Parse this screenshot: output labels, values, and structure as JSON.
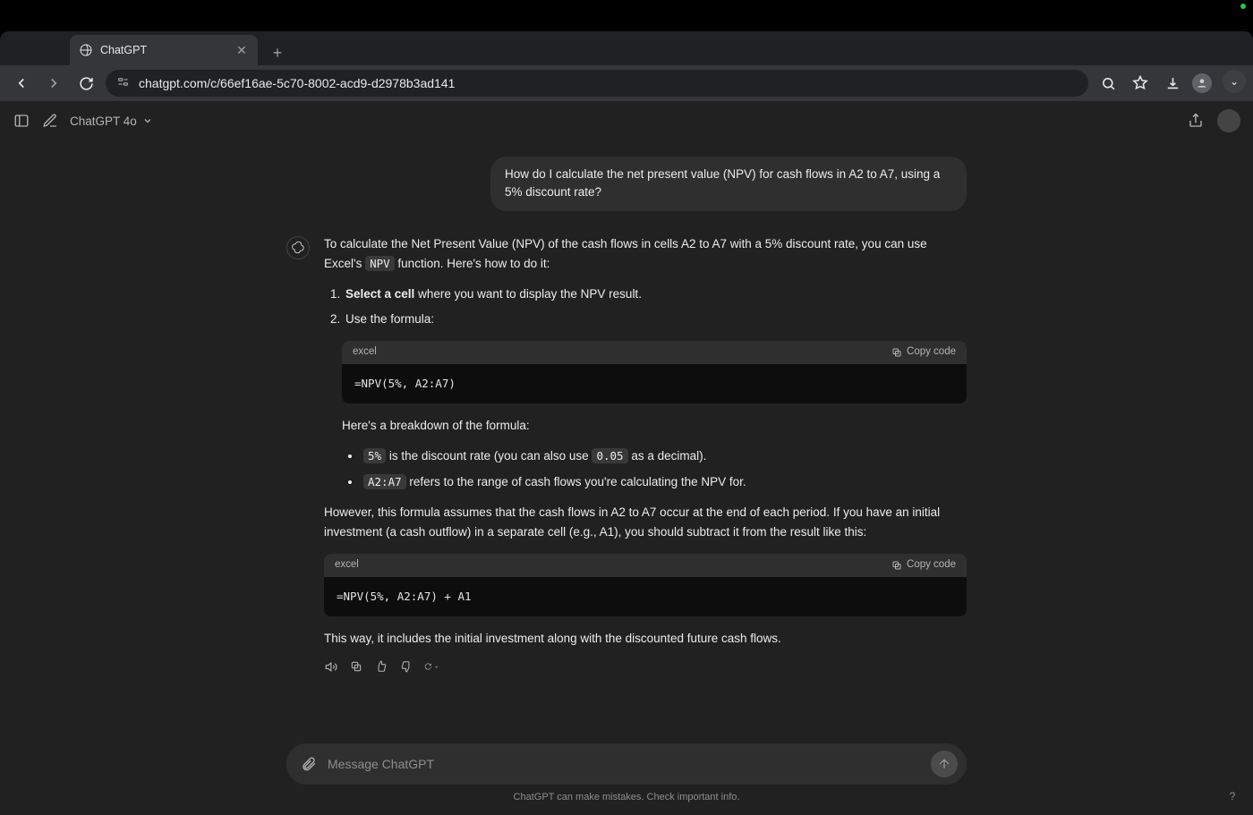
{
  "browser": {
    "tab_title": "ChatGPT",
    "url": "chatgpt.com/c/66ef16ae-5c70-8002-acd9-d2978b3ad141"
  },
  "header": {
    "model": "ChatGPT 4o"
  },
  "chat": {
    "user_message": "How do I calculate the net present value (NPV) for cash flows in A2 to A7, using a 5% discount rate?",
    "assistant": {
      "intro_a": "To calculate the Net Present Value (NPV) of the cash flows in cells A2 to A7 with a 5% discount rate, you can use Excel's ",
      "intro_code": "NPV",
      "intro_b": " function. Here's how to do it:",
      "step1_strong": "Select a cell",
      "step1_rest": " where you want to display the NPV result.",
      "step2": "Use the formula:",
      "code1_lang": "excel",
      "copy_label": "Copy code",
      "code1": "=NPV(5%, A2:A7)",
      "breakdown_intro": "Here's a breakdown of the formula:",
      "bullet1_code": "5%",
      "bullet1_mid": " is the discount rate (you can also use ",
      "bullet1_code2": "0.05",
      "bullet1_end": " as a decimal).",
      "bullet2_code": "A2:A7",
      "bullet2_rest": " refers to the range of cash flows you're calculating the NPV for.",
      "however": "However, this formula assumes that the cash flows in A2 to A7 occur at the end of each period. If you have an initial investment (a cash outflow) in a separate cell (e.g., A1), you should subtract it from the result like this:",
      "code2_lang": "excel",
      "code2": "=NPV(5%, A2:A7) + A1",
      "closing": "This way, it includes the initial investment along with the discounted future cash flows."
    }
  },
  "composer": {
    "placeholder": "Message ChatGPT"
  },
  "footer": {
    "disclaimer": "ChatGPT can make mistakes. Check important info."
  }
}
